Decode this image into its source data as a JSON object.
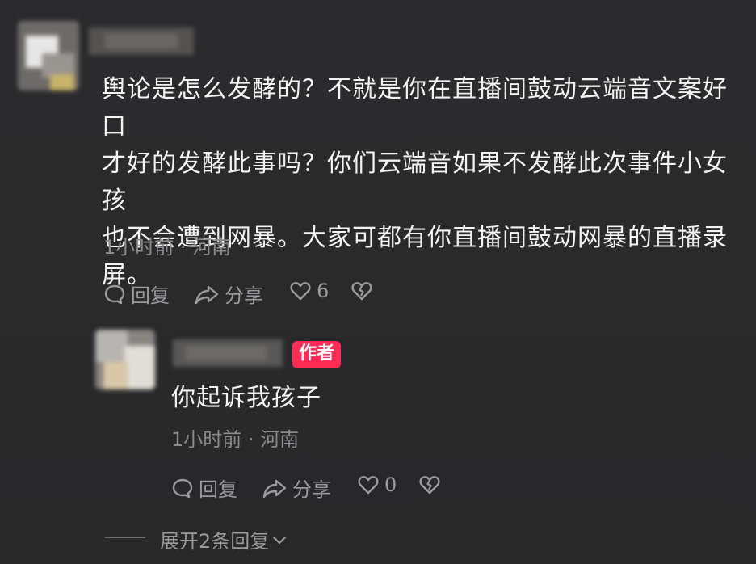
{
  "comment": {
    "text_lines": [
      "舆论是怎么发酵的？不就是你在直播间鼓动云端音文案好口",
      "才好的发酵此事吗？你们云端音如果不发酵此次事件小女孩",
      "也不会遭到网暴。大家可都有你直播间鼓动网暴的直播录",
      "屏。"
    ],
    "meta": "1小时前 · 河南",
    "actions": {
      "reply_label": "回复",
      "share_label": "分享",
      "like_count": "6"
    }
  },
  "reply": {
    "badge": "作者",
    "text": "你起诉我孩子",
    "meta": "1小时前 · 河南",
    "actions": {
      "reply_label": "回复",
      "share_label": "分享",
      "like_count": "0"
    }
  },
  "expand_replies": {
    "label": "展开2条回复"
  },
  "colors": {
    "badge": "#fe2c55",
    "meta_text": "#8c8a8f",
    "body_text": "#f2f2f2"
  }
}
